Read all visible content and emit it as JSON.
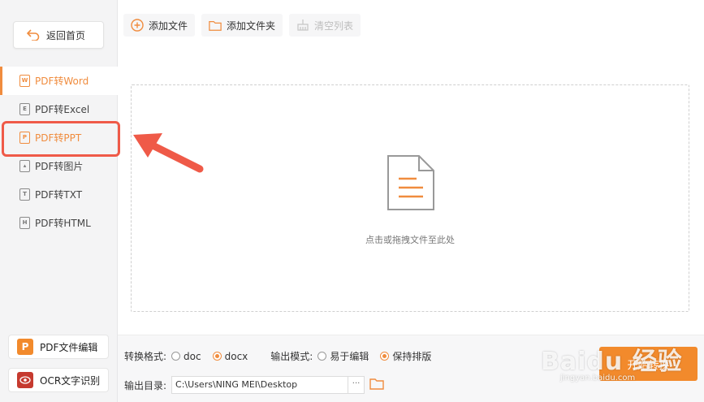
{
  "sidebar": {
    "back_label": "返回首页",
    "items": [
      {
        "icon": "W",
        "label": "PDF转Word",
        "state": "active"
      },
      {
        "icon": "E",
        "label": "PDF转Excel",
        "state": ""
      },
      {
        "icon": "P",
        "label": "PDF转PPT",
        "state": "highlight"
      },
      {
        "icon": "img",
        "label": "PDF转图片",
        "state": ""
      },
      {
        "icon": "T",
        "label": "PDF转TXT",
        "state": ""
      },
      {
        "icon": "H",
        "label": "PDF转HTML",
        "state": ""
      }
    ],
    "tools": [
      {
        "logo": "P",
        "label": "PDF文件编辑"
      },
      {
        "logo": "ocr",
        "label": "OCR文字识别"
      }
    ]
  },
  "toolbar": {
    "add_file": "添加文件",
    "add_folder": "添加文件夹",
    "clear_list": "清空列表"
  },
  "dropzone": {
    "hint": "点击或拖拽文件至此处"
  },
  "options": {
    "format_label": "转换格式:",
    "format_options": [
      "doc",
      "docx"
    ],
    "format_selected": "docx",
    "mode_label": "输出模式:",
    "mode_options": [
      "易于编辑",
      "保持排版"
    ],
    "mode_selected": "保持排版",
    "output_label": "输出目录:",
    "output_path": "C:\\Users\\NING MEI\\Desktop",
    "browse_label": "···"
  },
  "start_button": "开始转换",
  "watermark": {
    "text": "Baidu 经验",
    "sub": "jingyan.baidu.com"
  },
  "colors": {
    "accent": "#f08c3e",
    "annotation": "#ef5a48"
  }
}
